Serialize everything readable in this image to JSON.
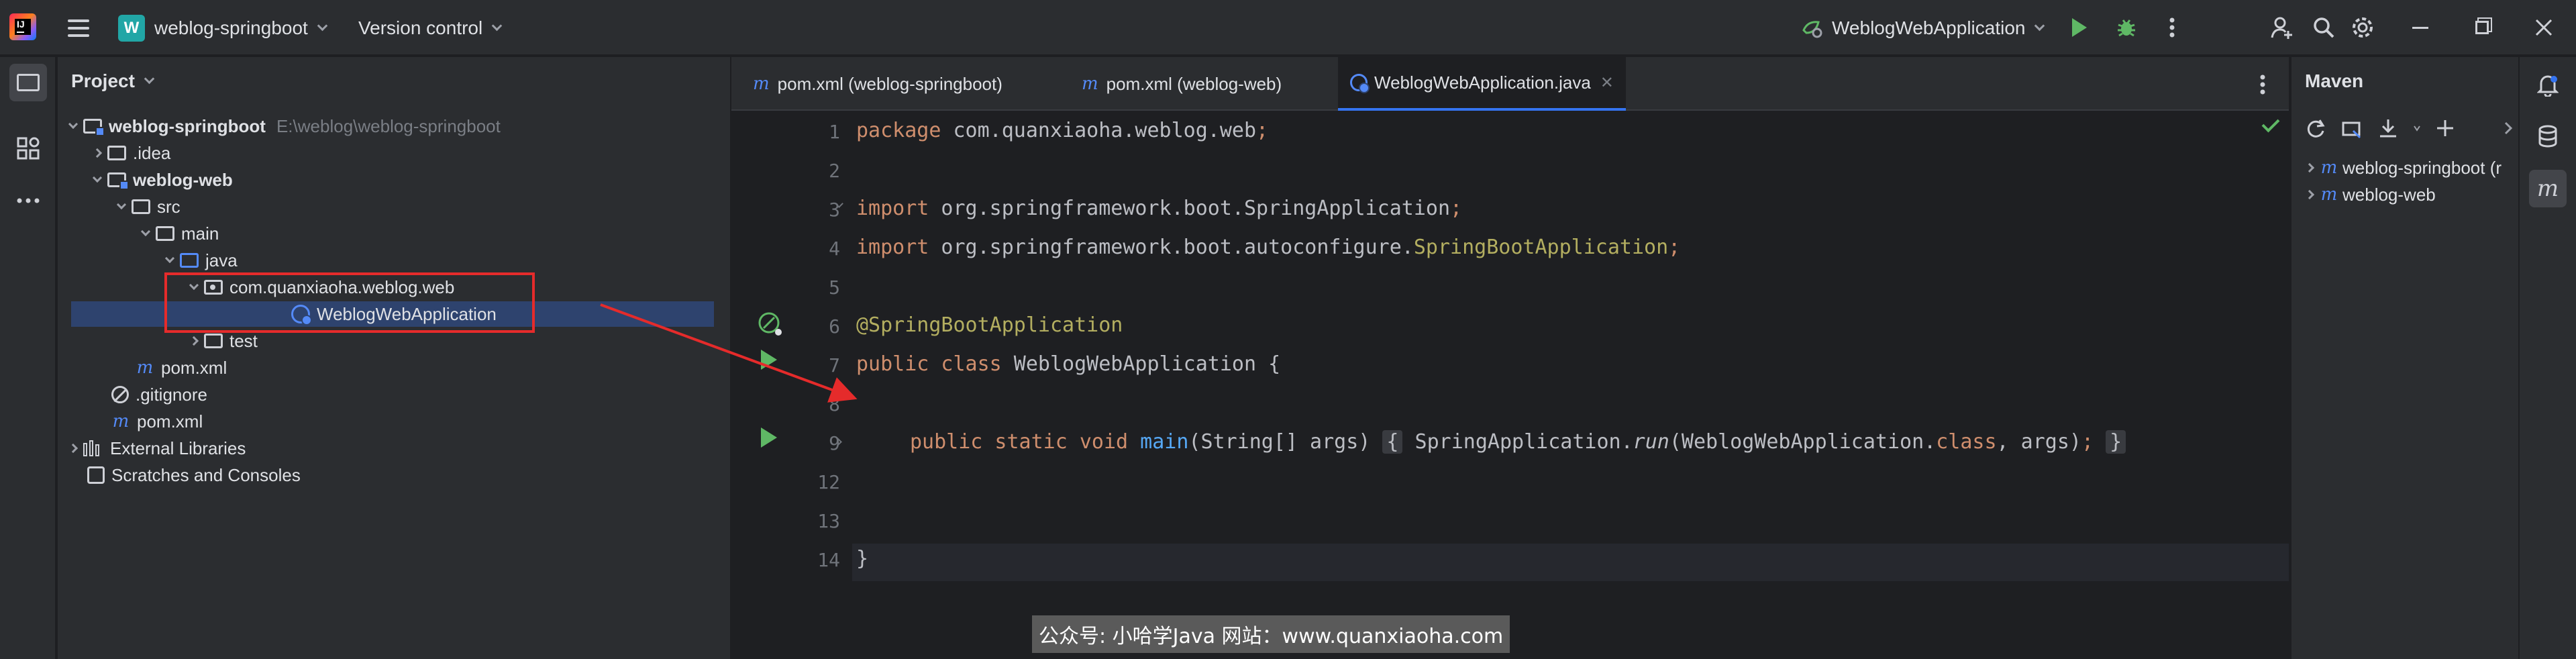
{
  "titlebar": {
    "project_name": "weblog-springboot",
    "project_badge": "W",
    "vcs_label": "Version control",
    "run_config": "WeblogWebApplication"
  },
  "project_panel": {
    "title": "Project",
    "tree": [
      {
        "label": "weblog-springboot",
        "path": "E:\\weblog\\weblog-springboot"
      },
      {
        "label": ".idea"
      },
      {
        "label": "weblog-web"
      },
      {
        "label": "src"
      },
      {
        "label": "main"
      },
      {
        "label": "java"
      },
      {
        "label": "com.quanxiaoha.weblog.web"
      },
      {
        "label": "WeblogWebApplication"
      },
      {
        "label": "test"
      },
      {
        "label": "pom.xml"
      },
      {
        "label": ".gitignore"
      },
      {
        "label": "pom.xml"
      },
      {
        "label": "External Libraries"
      },
      {
        "label": "Scratches and Consoles"
      }
    ]
  },
  "editor": {
    "tabs": [
      {
        "label": "pom.xml (weblog-springboot)"
      },
      {
        "label": "pom.xml (weblog-web)"
      },
      {
        "label": "WeblogWebApplication.java"
      }
    ],
    "line_numbers": [
      "1",
      "2",
      "3",
      "4",
      "5",
      "6",
      "7",
      "8",
      "9",
      "12",
      "13",
      "14"
    ],
    "code": {
      "l1": {
        "kw": "package",
        "rest": " com.quanxiaoha.weblog.web",
        "semi": ";"
      },
      "l3": {
        "kw": "import",
        "rest": " org.springframework.boot.SpringApplication",
        "semi": ";"
      },
      "l4": {
        "kw": "import",
        "rest": " org.springframework.boot.autoconfigure.",
        "ann": "SpringBootApplication",
        "semi": ";"
      },
      "l6": {
        "ann": "@SpringBootApplication"
      },
      "l7": {
        "kw": "public class",
        "rest": " WeblogWebApplication {"
      },
      "l9": {
        "kw": "public static void",
        "fn": "main",
        "args": "(String[] args)",
        "open": "{",
        "call1": " SpringApplication.",
        "run": "run",
        "call2": "(WeblogWebApplication.",
        "cls": "class",
        "tail": ", args)",
        "semi": ";",
        "close": "}"
      },
      "l13": {
        "text": "}"
      }
    },
    "watermark": "公众号: 小哈学Java  网站：www.quanxiaoha.com"
  },
  "maven": {
    "title": "Maven",
    "items": [
      {
        "label": "weblog-springboot (r"
      },
      {
        "label": "weblog-web"
      }
    ]
  }
}
